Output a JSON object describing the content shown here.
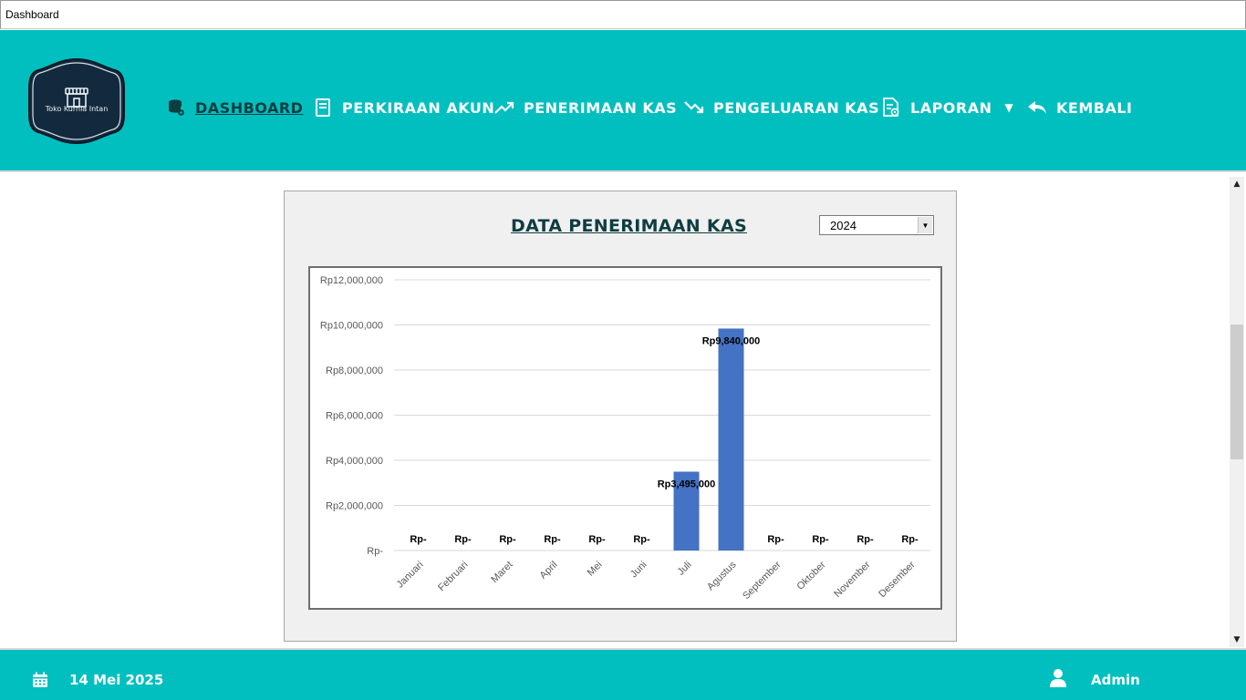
{
  "window": {
    "title": "Dashboard"
  },
  "logo": {
    "text": "Toko Kurnia Intan"
  },
  "nav": [
    {
      "label": "DASHBOARD",
      "icon": "database-icon",
      "active": true
    },
    {
      "label": "PERKIRAAN AKUN",
      "icon": "document-icon",
      "active": false
    },
    {
      "label": "PENERIMAAN KAS",
      "icon": "trend-up-icon",
      "active": false
    },
    {
      "label": "PENGELUARAN KAS",
      "icon": "trend-down-icon",
      "active": false
    },
    {
      "label": "LAPORAN",
      "icon": "report-icon",
      "active": false
    },
    {
      "label": "KEMBALI",
      "icon": "reply-icon",
      "active": false
    }
  ],
  "panel": {
    "title": "DATA PENERIMAAN KAS",
    "year_selected": "2024"
  },
  "chart_data": {
    "type": "bar",
    "categories": [
      "Januari",
      "Februari",
      "Maret",
      "April",
      "Mei",
      "Juni",
      "Juli",
      "Agustus",
      "September",
      "Oktober",
      "November",
      "Desember"
    ],
    "values": [
      0,
      0,
      0,
      0,
      0,
      0,
      3495000,
      9840000,
      0,
      0,
      0,
      0
    ],
    "data_labels": [
      "Rp-",
      "Rp-",
      "Rp-",
      "Rp-",
      "Rp-",
      "Rp-",
      "Rp3,495,000",
      "Rp9,840,000",
      "Rp-",
      "Rp-",
      "Rp-",
      "Rp-"
    ],
    "y_tick_labels": [
      "Rp-",
      "Rp2,000,000",
      "Rp4,000,000",
      "Rp6,000,000",
      "Rp8,000,000",
      "Rp10,000,000",
      "Rp12,000,000"
    ],
    "y_ticks": [
      0,
      2000000,
      4000000,
      6000000,
      8000000,
      10000000,
      12000000
    ],
    "ylim": [
      0,
      12000000
    ],
    "title": "",
    "xlabel": "",
    "ylabel": "",
    "grid": true,
    "bar_color": "#4472c4"
  },
  "footer": {
    "date": "14 Mei 2025",
    "user": "Admin"
  },
  "colors": {
    "header_bg": "#01bfbf",
    "active_nav": "#0f3d40",
    "logo_bg": "#132a3e"
  }
}
